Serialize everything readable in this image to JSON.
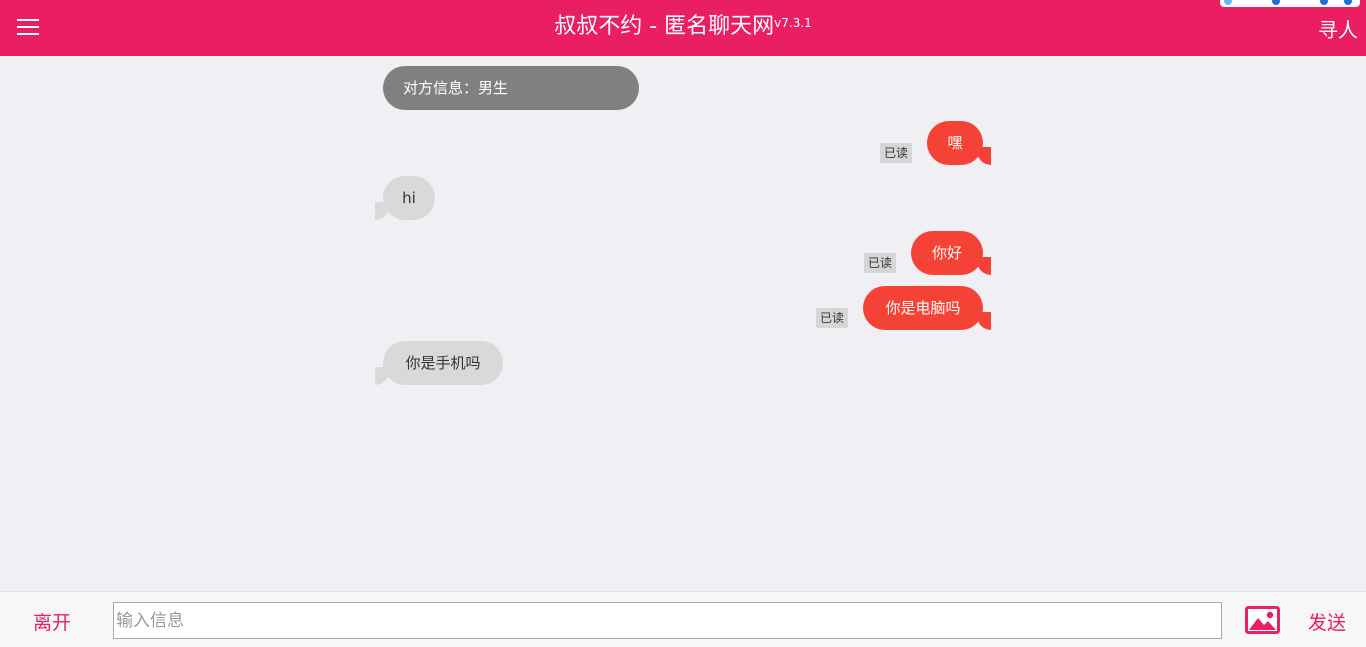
{
  "header": {
    "title": "叔叔不约 - 匿名聊天网",
    "version": "v7.3.1",
    "find_label": "寻人",
    "menu_icon": "hamburger-menu-icon"
  },
  "messages": [
    {
      "type": "info",
      "text": "对方信息：男生"
    },
    {
      "type": "self",
      "text": "嘿",
      "status": "已读"
    },
    {
      "type": "other",
      "text": "hi"
    },
    {
      "type": "self",
      "text": "你好",
      "status": "已读"
    },
    {
      "type": "self",
      "text": "你是电脑吗",
      "status": "已读"
    },
    {
      "type": "other",
      "text": "你是手机吗"
    }
  ],
  "footer": {
    "leave_label": "离开",
    "input_value": "",
    "input_placeholder": "输入信息",
    "image_icon": "image-upload-icon",
    "send_label": "发送"
  },
  "colors": {
    "brand": "#e91e63",
    "self_bubble": "#f44336",
    "other_bubble": "#d9d9d9",
    "info_bubble": "#808080",
    "background": "#efeff4"
  }
}
